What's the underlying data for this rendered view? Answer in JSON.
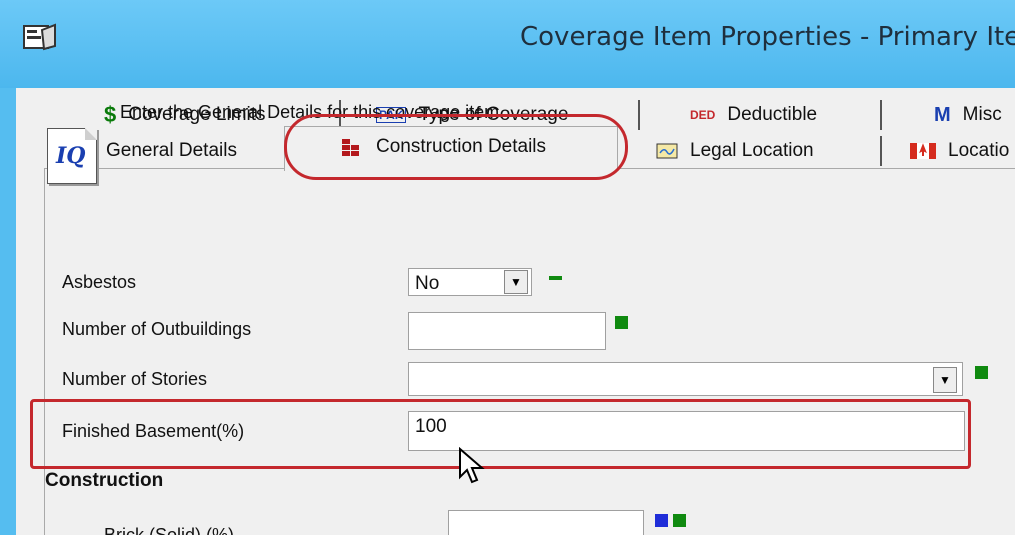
{
  "window": {
    "title": "Coverage Item Properties - Primary Ite"
  },
  "tabs_row1": [
    {
      "label": "Coverage Limits",
      "icon": "$"
    },
    {
      "label": "Type of Coverage",
      "icon": "PAK"
    },
    {
      "label": "Deductible",
      "icon": "DED"
    },
    {
      "label": "Misc",
      "icon": "M"
    }
  ],
  "tabs_row2": [
    {
      "label": "General Details",
      "icon": "house-icon"
    },
    {
      "label": "Construction Details",
      "icon": "bricks-icon"
    },
    {
      "label": "Legal Location",
      "icon": "map-icon"
    },
    {
      "label": "Locatio",
      "icon": "canada-flag-icon"
    }
  ],
  "panel": {
    "info": "Enter the General Details for this coverage item.",
    "iq_logo": "IQ",
    "fields": {
      "asbestos": {
        "label": "Asbestos",
        "value": "No"
      },
      "outbuildings": {
        "label": "Number of Outbuildings",
        "value": ""
      },
      "stories": {
        "label": "Number of Stories",
        "value": ""
      },
      "basement": {
        "label": "Finished Basement(%)",
        "value": "100"
      }
    },
    "section_construction": "Construction",
    "brick": {
      "label": "Brick (Solid) (%)",
      "value": ""
    }
  },
  "colors": {
    "title_bar": "#55bdf0",
    "callout": "#c4282d",
    "indicator_green": "#108a10",
    "indicator_blue": "#1f2dd8"
  }
}
